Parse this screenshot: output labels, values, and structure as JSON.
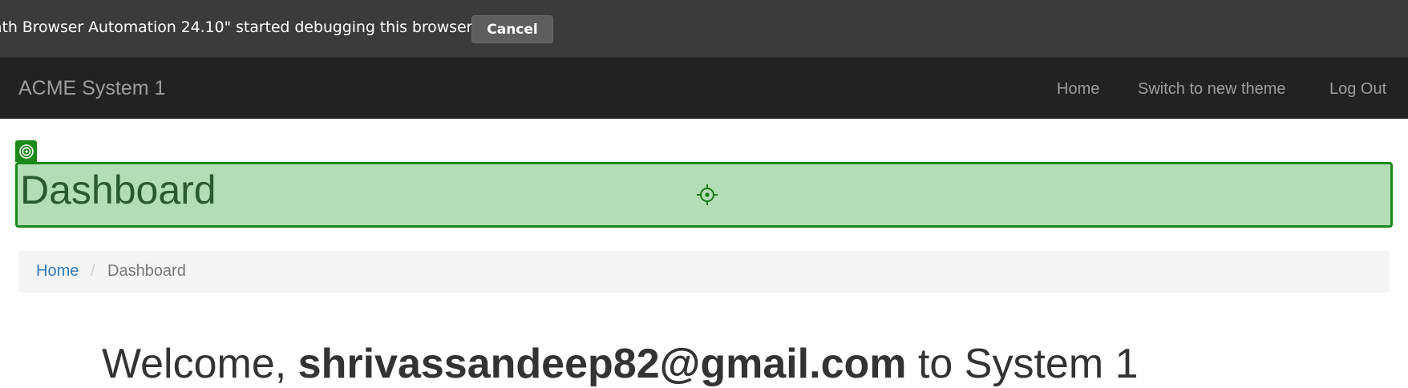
{
  "debug_bar": {
    "message": "ath Browser Automation 24.10\" started debugging this browser",
    "cancel_label": "Cancel"
  },
  "navbar": {
    "brand": "ACME System 1",
    "links": [
      "Home",
      "Switch to new theme",
      "Log Out"
    ]
  },
  "page": {
    "title": "Dashboard"
  },
  "breadcrumb": {
    "home": "Home",
    "separator": "/",
    "current": "Dashboard"
  },
  "welcome": {
    "prefix": "Welcome,",
    "user": "shrivassandeep82@gmail.com",
    "suffix": "to System 1"
  },
  "icons": {
    "target_badge": "target-icon",
    "crosshair": "crosshair-icon"
  },
  "colors": {
    "highlight_fill": "#b3deb5",
    "highlight_border": "#1b8a1b",
    "navbar_bg": "#222222",
    "link_blue": "#337ab7"
  }
}
